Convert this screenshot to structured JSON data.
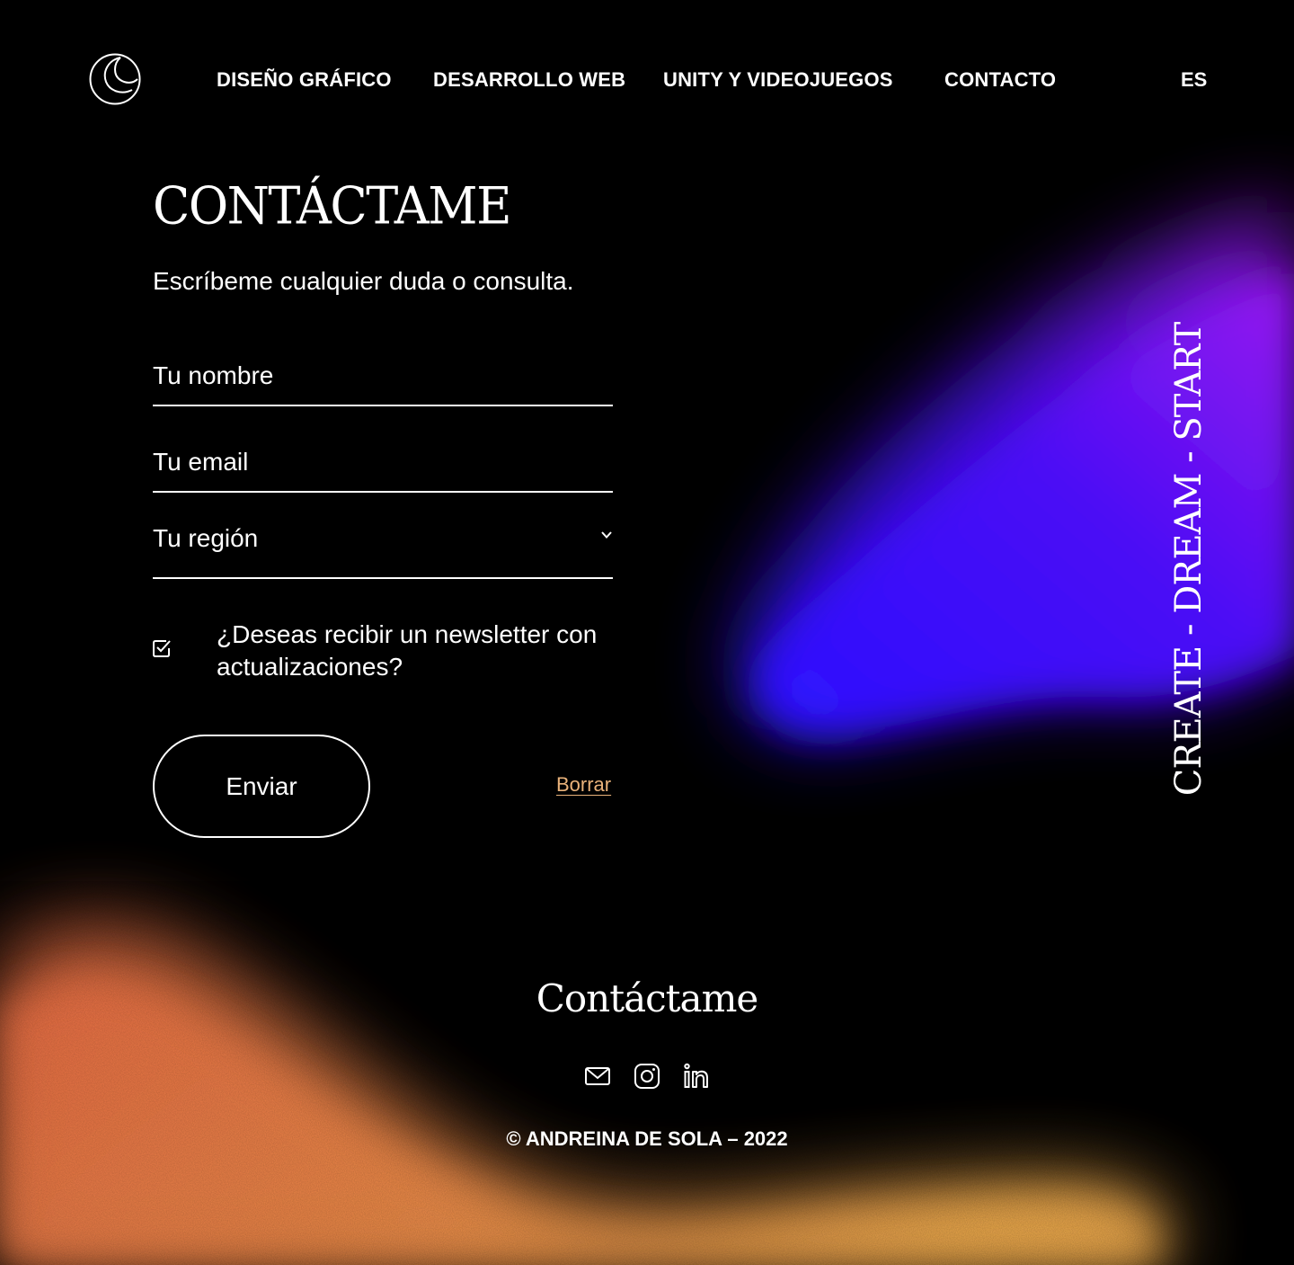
{
  "nav": {
    "items": [
      {
        "label": "DISEÑO GRÁFICO"
      },
      {
        "label": "DESARROLLO WEB"
      },
      {
        "label": "UNITY Y VIDEOJUEGOS"
      },
      {
        "label": "CONTACTO"
      }
    ],
    "language": "ES"
  },
  "contact": {
    "title": "CONTÁCTAME",
    "intro": "Escríbeme cualquier duda o consulta.",
    "name_placeholder": "Tu nombre",
    "email_placeholder": "Tu email",
    "region_placeholder": "Tu región",
    "newsletter_label": "¿Deseas recibir un newsletter con actualizaciones?",
    "newsletter_checked": true,
    "submit_label": "Enviar",
    "reset_label": "Borrar"
  },
  "tagline": "CREATE - DREAM - START",
  "footer": {
    "title": "Contáctame",
    "social": [
      "mail-icon",
      "instagram-icon",
      "linkedin-icon"
    ],
    "copyright": "© ANDREINA DE SOLA – 2022"
  },
  "colors": {
    "background": "#000000",
    "text": "#ffffff",
    "link_accent": "#e9b27a",
    "blob_blue": "#3a10ff",
    "blob_purple": "#8a12f0",
    "blob_orange": "#f07a45",
    "blob_yellow": "#f5ad4a"
  }
}
